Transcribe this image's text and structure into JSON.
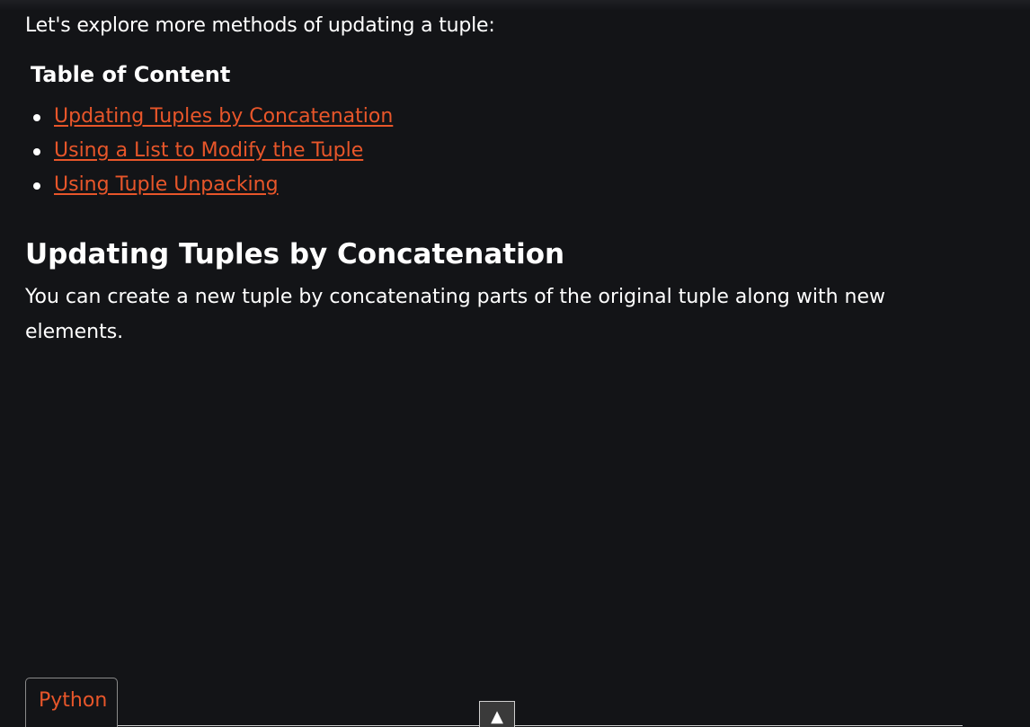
{
  "intro_text": "Let's explore more methods of updating a tuple:",
  "toc": {
    "title": "Table of Content",
    "items": [
      {
        "label": "Updating Tuples by Concatenation"
      },
      {
        "label": "Using a List to Modify the Tuple"
      },
      {
        "label": "Using Tuple Unpacking"
      }
    ]
  },
  "section": {
    "heading": "Updating Tuples by Concatenation",
    "text": "You can create a new tuple by concatenating parts of the original tuple along with new elements."
  },
  "code_block": {
    "language_tab": "Python"
  },
  "scroll_top": {
    "icon": "▲",
    "icon_name": "arrow-up-icon"
  },
  "colors": {
    "background": "#131417",
    "link": "#e8562a",
    "text": "#ffffff"
  }
}
